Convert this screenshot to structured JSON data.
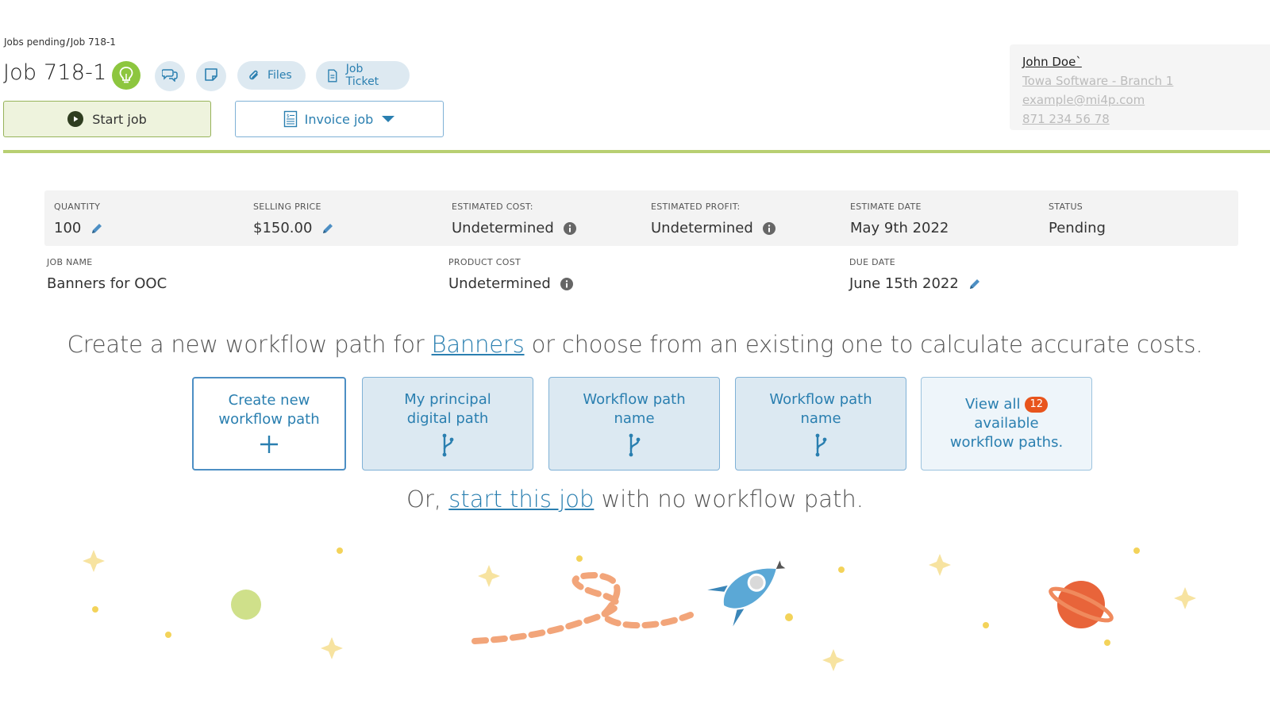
{
  "breadcrumb": {
    "parent": "Jobs pending",
    "separator": "/",
    "current": "Job 718-1"
  },
  "job": {
    "title": "Job 718-1"
  },
  "toolbar": {
    "files_label": "Files",
    "ticket_label": "Job Ticket"
  },
  "actions": {
    "start_label": "Start job",
    "invoice_label": "Invoice job"
  },
  "contact": {
    "name": "John Doe`",
    "company": "Towa Software - Branch 1",
    "email": "example@mi4p.com",
    "phone": "871 234 56 78"
  },
  "summary": [
    {
      "label": "QUANTITY",
      "value": "100"
    },
    {
      "label": "SELLING PRICE",
      "value": "$150.00"
    },
    {
      "label": "ESTIMATED COST:",
      "value": "Undetermined"
    },
    {
      "label": "ESTIMATED PROFIT:",
      "value": "Undetermined"
    },
    {
      "label": "ESTIMATE DATE",
      "value": "May 9th 2022"
    },
    {
      "label": "STATUS",
      "value": "Pending"
    }
  ],
  "details": [
    {
      "label": "JOB NAME",
      "value": "Banners for OOC"
    },
    {
      "label": "PRODUCT COST",
      "value": "Undetermined"
    },
    {
      "label": "DUE DATE",
      "value": "June 15th 2022"
    }
  ],
  "prompt": {
    "before": "Create a new workflow path for ",
    "link": "Banners",
    "after": " or choose from an existing one to calculate accurate costs."
  },
  "cards": {
    "create": {
      "line1": "Create new",
      "line2": "workflow path"
    },
    "principal": {
      "line1": "My principal",
      "line2": "digital path"
    },
    "path1": {
      "line1": "Workflow path",
      "line2": "name"
    },
    "path2": {
      "line1": "Workflow path",
      "line2": "name"
    },
    "view_all": {
      "prefix": "View all",
      "count": "12",
      "line2": "available",
      "line3": "workflow paths."
    }
  },
  "or_line": {
    "before": "Or, ",
    "link": "start this job",
    "after": " with no workflow path."
  },
  "colors": {
    "accent_blue": "#2a7fb0",
    "accent_green": "#8dc63f",
    "badge": "#e8541c"
  }
}
